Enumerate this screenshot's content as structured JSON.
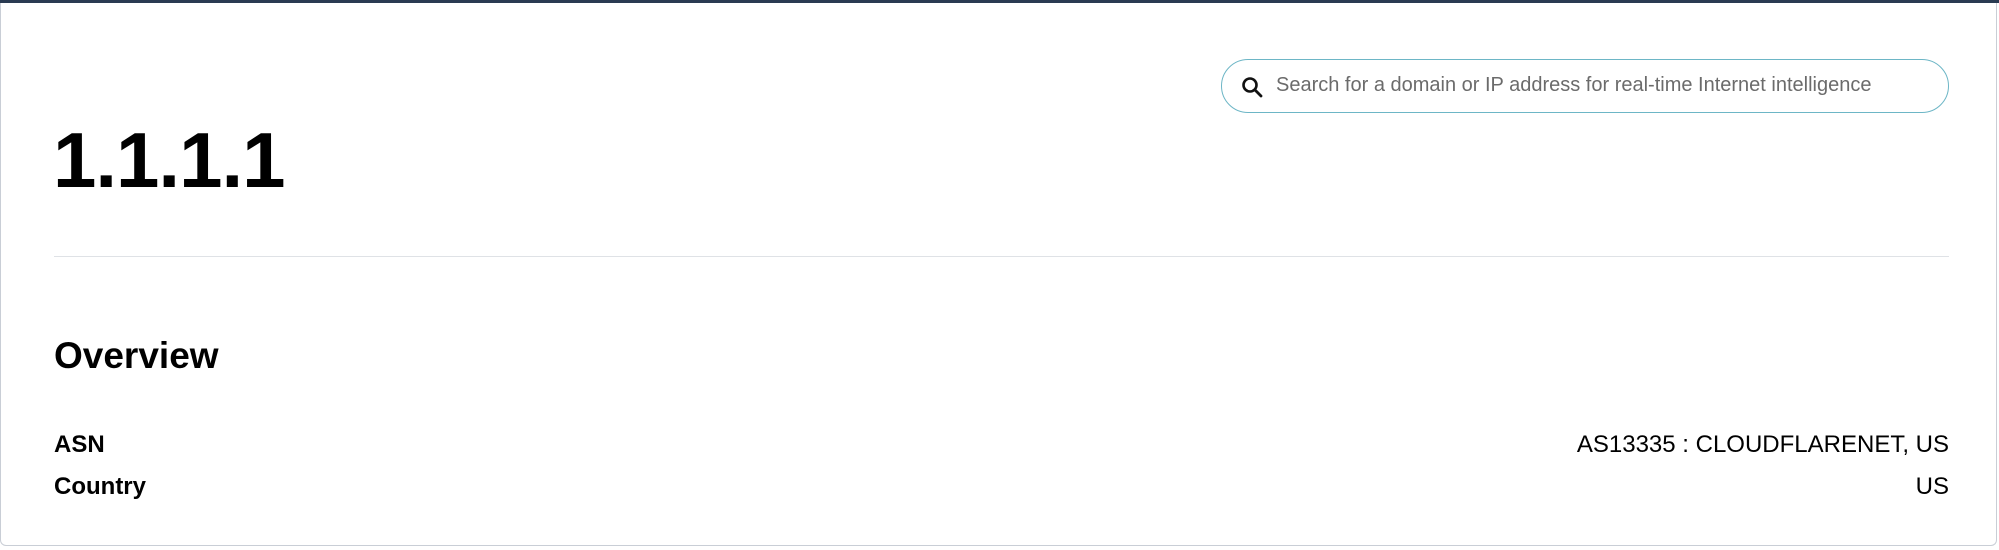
{
  "search": {
    "placeholder": "Search for a domain or IP address for real-time Internet intelligence",
    "value": "",
    "icon": "search-icon"
  },
  "page": {
    "title": "1.1.1.1"
  },
  "overview": {
    "title": "Overview",
    "rows": [
      {
        "label": "ASN",
        "value": "AS13335 : CLOUDFLARENET, US"
      },
      {
        "label": "Country",
        "value": "US"
      }
    ]
  },
  "colors": {
    "search_border": "#6db6c6",
    "top_bar": "#2a3b52",
    "divider": "#dfe2e6"
  }
}
